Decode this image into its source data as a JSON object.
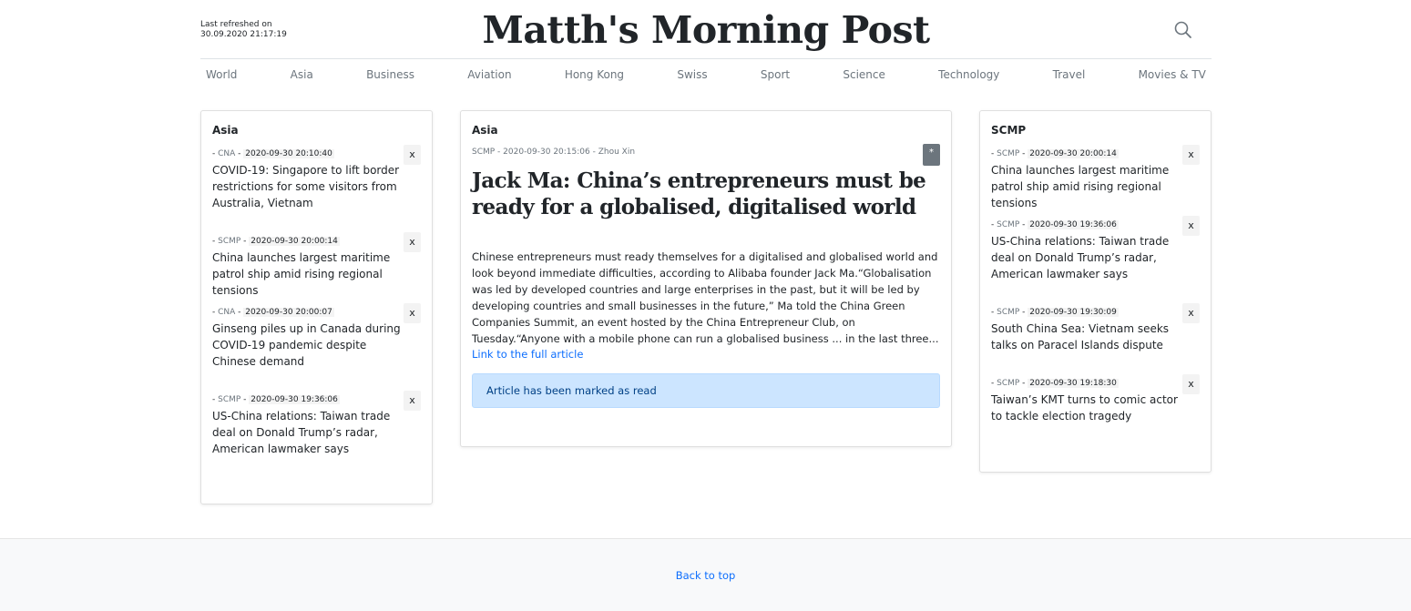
{
  "header": {
    "refresh_label": "Last refreshed on",
    "refresh_time": "30.09.2020 21:17:19",
    "site_title": "Matth's Morning Post",
    "search_icon": "search-icon"
  },
  "nav": [
    "World",
    "Asia",
    "Business",
    "Aviation",
    "Hong Kong",
    "Swiss",
    "Sport",
    "Science",
    "Technology",
    "Travel",
    "Movies & TV"
  ],
  "left_panel": {
    "title": "Asia",
    "items": [
      {
        "source": "CNA",
        "date": "2020-09-30 20:10:40",
        "headline": "COVID-19: Singapore to lift border restrictions for some visitors from Australia, Vietnam"
      },
      {
        "source": "SCMP",
        "date": "2020-09-30 20:00:14",
        "headline": "China launches largest maritime patrol ship amid rising regional tensions"
      },
      {
        "source": "CNA",
        "date": "2020-09-30 20:00:07",
        "headline": "Ginseng piles up in Canada during COVID-19 pandemic despite Chinese demand"
      },
      {
        "source": "SCMP",
        "date": "2020-09-30 19:36:06",
        "headline": "US-China relations: Taiwan trade deal on Donald Trump’s radar, American lawmaker says"
      }
    ]
  },
  "article": {
    "category": "Asia",
    "meta": "SCMP - 2020-09-30 20:15:06 - Zhou Xin",
    "star_label": "*",
    "title": "Jack Ma: China’s entrepreneurs must be ready for a globalised, digitalised world",
    "body": "Chinese entrepreneurs must ready themselves for a digitalised and globalised world and look beyond immediate difficulties, according to Alibaba founder Jack Ma.“Globalisation was led by developed countries and large enterprises in the past, but it will be led by developing countries and small businesses in the future,” Ma told the China Green Companies Summit, an event hosted by the China Entrepreneur Club, on Tuesday.“Anyone with a mobile phone can run a globalised business ... in the last three...",
    "link_label": "Link to the full article",
    "alert": "Article has been marked as read"
  },
  "right_panel": {
    "title": "SCMP",
    "items": [
      {
        "source": "SCMP",
        "date": "2020-09-30 20:00:14",
        "headline": "China launches largest maritime patrol ship amid rising regional tensions"
      },
      {
        "source": "SCMP",
        "date": "2020-09-30 19:36:06",
        "headline": "US-China relations: Taiwan trade deal on Donald Trump’s radar, American lawmaker says"
      },
      {
        "source": "SCMP",
        "date": "2020-09-30 19:30:09",
        "headline": "South China Sea: Vietnam seeks talks on Paracel Islands dispute"
      },
      {
        "source": "SCMP",
        "date": "2020-09-30 19:18:30",
        "headline": "Taiwan’s KMT turns to comic actor to tackle election tragedy"
      }
    ]
  },
  "dismiss_label": "x",
  "footer": {
    "back_to_top": "Back to top"
  },
  "colors": {
    "link": "#0d6efd",
    "alert_bg": "#cce5ff",
    "alert_text": "#004085",
    "muted": "#6c757d"
  }
}
